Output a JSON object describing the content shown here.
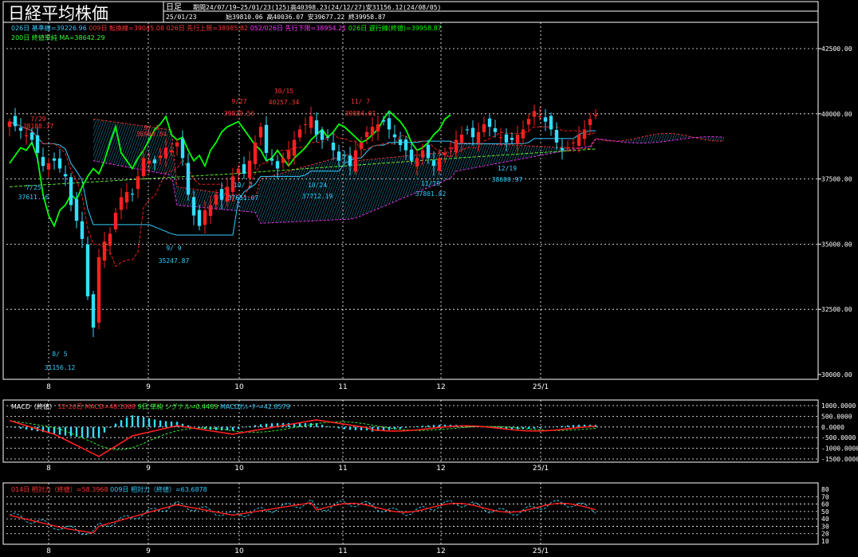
{
  "header": {
    "title": "日経平均株価",
    "period_type": "日足",
    "period_range": "期間24/07/19~25/01/23(125)高40398.23(24/12/27)安31156.12(24/08/05)",
    "bar_date": "25/01/23",
    "bar_ohlc": "始39810.06 高40036.07 安39677.22 終39958.87"
  },
  "legend": {
    "line1": [
      {
        "text": "026日 基準線=39226.96",
        "color": "#33ccff"
      },
      {
        "text": "009日 転換線=39045.08",
        "color": "#ff3333"
      },
      {
        "text": "026日 先行上限=38985.82",
        "color": "#ff3333"
      },
      {
        "text": "052/026日 先行下限=38954.21",
        "color": "#ff33ff"
      },
      {
        "text": "026日 遅行線(終値)=39958.87",
        "color": "#00ff00"
      }
    ],
    "line2": [
      {
        "text": "200日 終値単純 MA=38642.29",
        "color": "#33ff33"
      }
    ]
  },
  "colors": {
    "up": "#ff2020",
    "down": "#33ddff",
    "kijun": "#33ccff",
    "tenkan": "#ff2020",
    "span_a": "#ff3333",
    "span_b": "#ff33ff",
    "chikou": "#00ff00",
    "ma200": "#66ff33",
    "grid": "#ffffff"
  },
  "chart_data": [
    {
      "type": "candlestick",
      "title": "日経平均株価",
      "ylim": [
        30000,
        43500
      ],
      "y_ticks": [
        "42500.00",
        "40000.00",
        "37500.00",
        "35000.00",
        "32500.00",
        "30000.00"
      ],
      "x_ticks": [
        "8",
        "9",
        "10",
        "11",
        "12",
        "25/1"
      ],
      "annotations": [
        {
          "label": "7/29",
          "value": "38188.37",
          "color": "#ff3333"
        },
        {
          "label": "7/25",
          "value": "37611.16",
          "color": "#33ccff"
        },
        {
          "label": "8/ 5",
          "value": "31156.12",
          "color": "#33ccff"
        },
        {
          "label": "9/ 3",
          "value": "38950.84",
          "color": "#ff3333"
        },
        {
          "label": "9/ 9",
          "value": "35247.87",
          "color": "#33ccff"
        },
        {
          "label": "9/27",
          "value": "39829.56",
          "color": "#ff3333"
        },
        {
          "label": "10/ 2",
          "value": "37651.07",
          "color": "#33ccff"
        },
        {
          "label": "10/15",
          "value": "40257.34",
          "color": "#ff3333"
        },
        {
          "label": "10/24",
          "value": "37712.19",
          "color": "#33ccff"
        },
        {
          "label": "11/ 7",
          "value": "39884.01",
          "color": "#ff3333"
        },
        {
          "label": "11/19",
          "value": "37801.82",
          "color": "#33ccff"
        },
        {
          "label": "12/19",
          "value": "38600.97",
          "color": "#33ccff"
        }
      ]
    },
    {
      "type": "line",
      "title": "MACD",
      "header_items": [
        {
          "text": "MACD（終値）",
          "color": "#ffffff"
        },
        {
          "text": "12-26日 MACD=48.1068",
          "color": "#ff3333"
        },
        {
          "text": "9日 単純 シグナル=0.4489",
          "color": "#33ff33"
        },
        {
          "text": "MACDｵｼﾚｰﾀｰ=42.8579",
          "color": "#33ccff"
        }
      ],
      "ylim": [
        -1750,
        1100
      ],
      "y_ticks": [
        "1000.0000",
        "500.0000",
        "0.0000",
        "-500.0000",
        "-1000.0000",
        "-1500.0000"
      ],
      "x_ticks": [
        "8",
        "9",
        "10",
        "11",
        "12",
        "25/1"
      ]
    },
    {
      "type": "line",
      "title": "RSI",
      "header_items": [
        {
          "text": "014日 相対力（終値）=58.3968",
          "color": "#ff3333"
        },
        {
          "text": "009日 相対力（終値）=63.6878",
          "color": "#33ccff"
        }
      ],
      "ylim": [
        10,
        80
      ],
      "y_ticks": [
        "80",
        "70",
        "60",
        "50",
        "40",
        "30",
        "20",
        "10"
      ],
      "x_ticks": [
        "8",
        "9",
        "10",
        "11",
        "12",
        "25/1"
      ]
    }
  ]
}
